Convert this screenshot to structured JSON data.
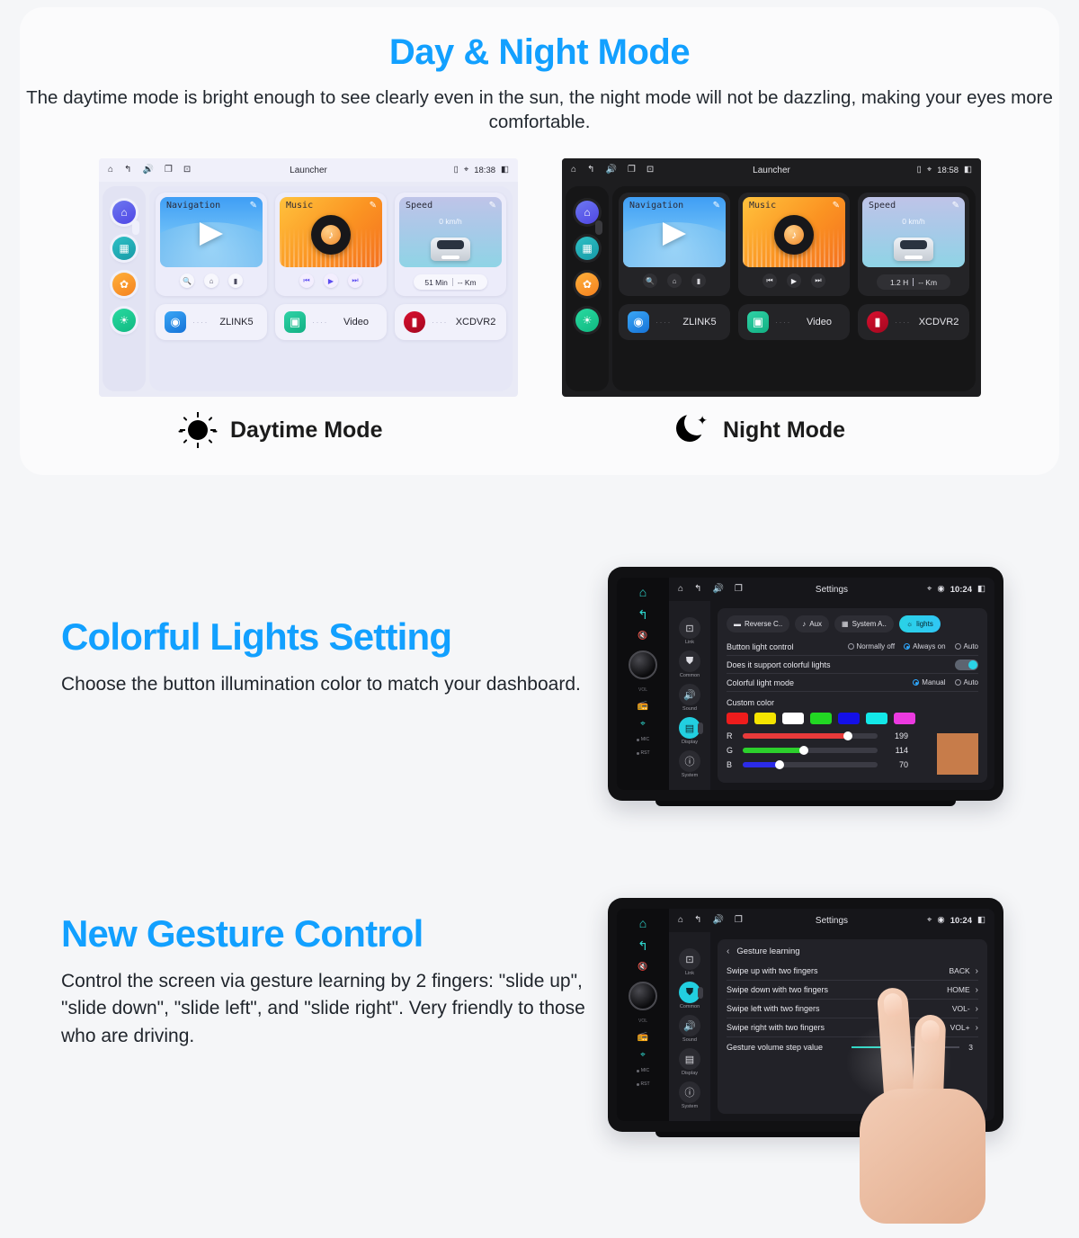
{
  "section1": {
    "title": "Day & Night Mode",
    "subtitle": "The daytime mode is bright enough to see clearly even in the sun, the night mode will not be dazzling, making your eyes more comfortable.",
    "day_caption": "Daytime Mode",
    "night_caption": "Night Mode",
    "accent_color": "#12a0ff",
    "day_screen": {
      "statusbar": {
        "title": "Launcher",
        "time": "18:38"
      },
      "widgets": [
        {
          "label": "Navigation",
          "controls": [
            "search-icon",
            "home-icon",
            "signal-icon"
          ]
        },
        {
          "label": "Music",
          "controls": [
            "prev-icon",
            "play-icon",
            "next-icon"
          ]
        },
        {
          "label": "Speed",
          "value": "0 km/h",
          "trip_time": "51 Min",
          "trip_distance": "-- Km"
        }
      ],
      "apps": [
        {
          "name": "ZLINK5"
        },
        {
          "name": "Video"
        },
        {
          "name": "XCDVR2"
        }
      ],
      "rail": [
        "home-icon",
        "apps-icon",
        "settings-icon",
        "brightness-icon"
      ]
    },
    "night_screen": {
      "statusbar": {
        "title": "Launcher",
        "time": "18:58"
      },
      "widgets": [
        {
          "label": "Navigation",
          "controls": [
            "search-icon",
            "home-icon",
            "signal-icon"
          ]
        },
        {
          "label": "Music",
          "controls": [
            "prev-icon",
            "play-icon",
            "next-icon"
          ]
        },
        {
          "label": "Speed",
          "value": "0 km/h",
          "trip_time": "1.2 H",
          "trip_distance": "-- Km"
        }
      ],
      "apps": [
        {
          "name": "ZLINK5"
        },
        {
          "name": "Video"
        },
        {
          "name": "XCDVR2"
        }
      ],
      "rail": [
        "home-icon",
        "apps-icon",
        "settings-icon",
        "brightness-icon"
      ]
    }
  },
  "section2": {
    "title": "Colorful Lights Setting",
    "body": "Choose the button illumination color to match your dashboard.",
    "screen": {
      "statusbar": {
        "title": "Settings",
        "time": "10:24"
      },
      "menu": [
        {
          "label": "Link",
          "icon": "link-icon"
        },
        {
          "label": "Common",
          "icon": "car-icon"
        },
        {
          "label": "Sound",
          "icon": "speaker-icon"
        },
        {
          "label": "Display",
          "icon": "display-icon",
          "active": true
        },
        {
          "label": "System",
          "icon": "info-icon"
        }
      ],
      "phys_labels": {
        "vol": "VOL",
        "mic": "MIC",
        "rst": "RST"
      },
      "chips": [
        {
          "label": "Reverse C..",
          "icon": "car-rear-icon",
          "active": false
        },
        {
          "label": "Aux",
          "icon": "aux-icon",
          "active": false
        },
        {
          "label": "System A..",
          "icon": "grid-icon",
          "active": false
        },
        {
          "label": "lights",
          "icon": "bulb-icon",
          "active": true
        }
      ],
      "rows": [
        {
          "label": "Button light control",
          "options": [
            {
              "label": "Normally off",
              "selected": false
            },
            {
              "label": "Always on",
              "selected": true
            },
            {
              "label": "Auto",
              "selected": false
            }
          ]
        },
        {
          "label": "Does it support colorful lights",
          "toggle": true
        },
        {
          "label": "Colorful light mode",
          "options": [
            {
              "label": "Manual",
              "selected": true
            },
            {
              "label": "Auto",
              "selected": false
            }
          ]
        }
      ],
      "custom_color_label": "Custom color",
      "swatches": [
        "#ee1c1c",
        "#f5e400",
        "#ffffff",
        "#22d723",
        "#1410e8",
        "#13e8e8",
        "#ec3ae0"
      ],
      "sliders": [
        {
          "channel": "R",
          "value": "199",
          "percent": 78,
          "color": "#e83a3a"
        },
        {
          "channel": "G",
          "value": "114",
          "percent": 45,
          "color": "#2cd02c"
        },
        {
          "channel": "B",
          "value": "70",
          "percent": 27,
          "color": "#2b2be8"
        }
      ],
      "preview_color": "#c77c4a"
    }
  },
  "section3": {
    "title": "New Gesture Control",
    "body": "Control the screen via gesture learning by 2 fingers: \"slide up\", \"slide down\", \"slide left\", and \"slide right\". Very friendly to those who are driving.",
    "screen": {
      "statusbar": {
        "title": "Settings",
        "time": "10:24"
      },
      "page_title": "Gesture learning",
      "menu": [
        {
          "label": "Link",
          "icon": "link-icon"
        },
        {
          "label": "Common",
          "icon": "car-icon",
          "active": true
        },
        {
          "label": "Sound",
          "icon": "speaker-icon"
        },
        {
          "label": "Display",
          "icon": "display-icon"
        },
        {
          "label": "System",
          "icon": "info-icon"
        }
      ],
      "phys_labels": {
        "vol": "VOL",
        "mic": "MIC",
        "rst": "RST"
      },
      "rows": [
        {
          "label": "Swipe up with two fingers",
          "value": "BACK"
        },
        {
          "label": "Swipe down with two fingers",
          "value": "HOME"
        },
        {
          "label": "Swipe left with two fingers",
          "value": "VOL-"
        },
        {
          "label": "Swipe right with two fingers",
          "value": "VOL+"
        }
      ],
      "step_row": {
        "label": "Gesture volume step value",
        "value": "3"
      }
    }
  }
}
